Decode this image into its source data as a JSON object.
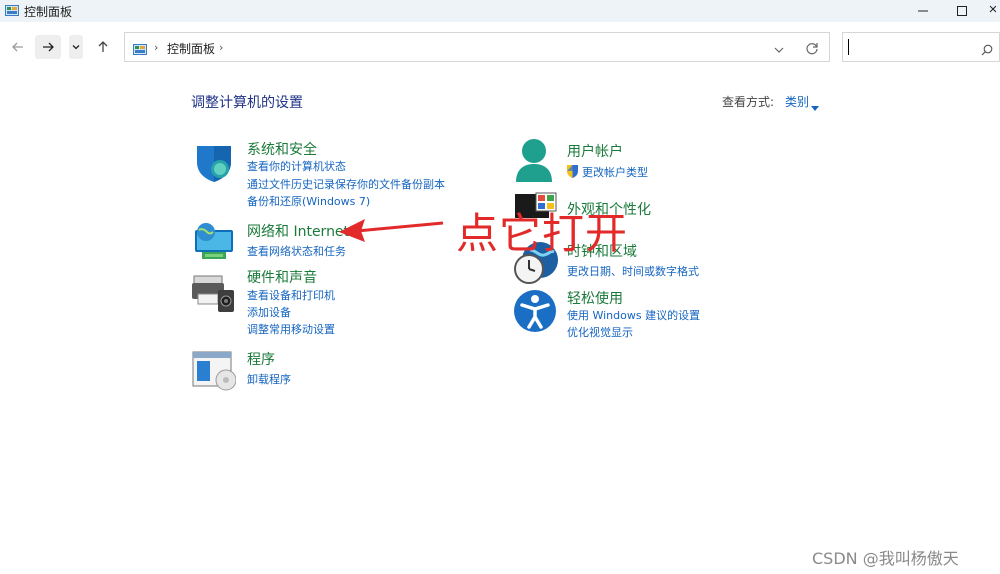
{
  "window": {
    "title": "控制面板"
  },
  "address": {
    "crumb": "控制面板",
    "sep": "›"
  },
  "search": {
    "placeholder": ""
  },
  "main": {
    "heading": "调整计算机的设置",
    "view_by_label": "查看方式:",
    "view_by_value": "类别"
  },
  "categories": {
    "system": {
      "title": "系统和安全",
      "links": [
        "查看你的计算机状态",
        "通过文件历史记录保存你的文件备份副本",
        "备份和还原(Windows 7)"
      ]
    },
    "network": {
      "title": "网络和 Internet",
      "links": [
        "查看网络状态和任务"
      ]
    },
    "hardware": {
      "title": "硬件和声音",
      "links": [
        "查看设备和打印机",
        "添加设备",
        "调整常用移动设置"
      ]
    },
    "programs": {
      "title": "程序",
      "links": [
        "卸载程序"
      ]
    },
    "accounts": {
      "title": "用户帐户",
      "links": [
        "更改帐户类型"
      ]
    },
    "appearance": {
      "title": "外观和个性化",
      "links": []
    },
    "clock": {
      "title": "时钟和区域",
      "links": [
        "更改日期、时间或数字格式"
      ]
    },
    "ease": {
      "title": "轻松使用",
      "links": [
        "使用 Windows 建议的设置",
        "优化视觉显示"
      ]
    }
  },
  "annotation": {
    "text": "点它打开",
    "color": "#e32a2a"
  },
  "watermark": "CSDN @我叫杨傲天",
  "colors": {
    "link": "#1565c0",
    "category": "#1a7a3a",
    "heading": "#1e3287",
    "titlebar": "#edf3f7"
  }
}
